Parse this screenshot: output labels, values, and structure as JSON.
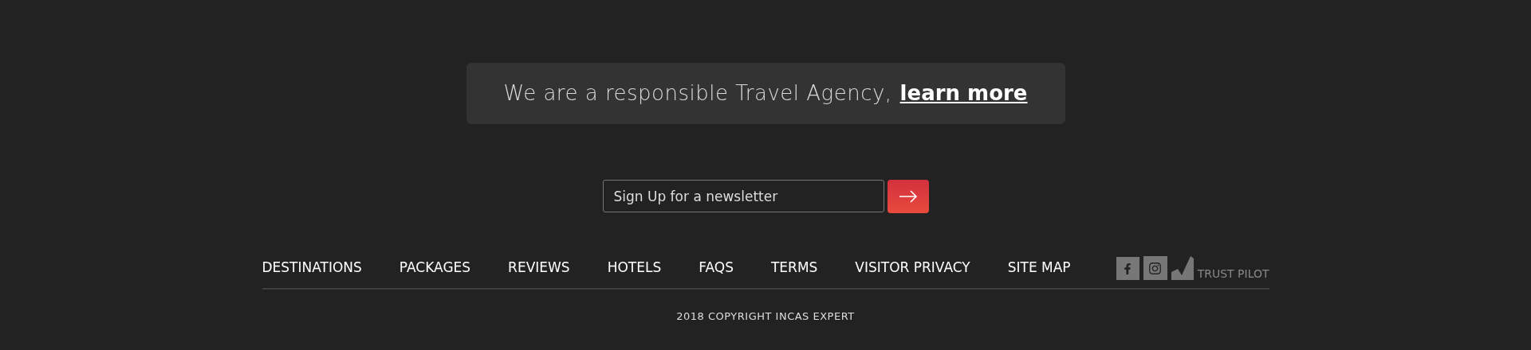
{
  "banner": {
    "text": "We are a responsible Travel Agency,",
    "link": "learn more"
  },
  "newsletter": {
    "placeholder": "Sign Up for a newsletter"
  },
  "nav": [
    "DESTINATIONS",
    "PACKAGES",
    "REVIEWS",
    "HOTELS",
    "FAQS",
    "TERMS",
    "VISITOR PRIVACY",
    "SITE MAP"
  ],
  "trust_label": "TRUST PILOT",
  "copyright": "2018 COPYRIGHT INCAS EXPERT"
}
